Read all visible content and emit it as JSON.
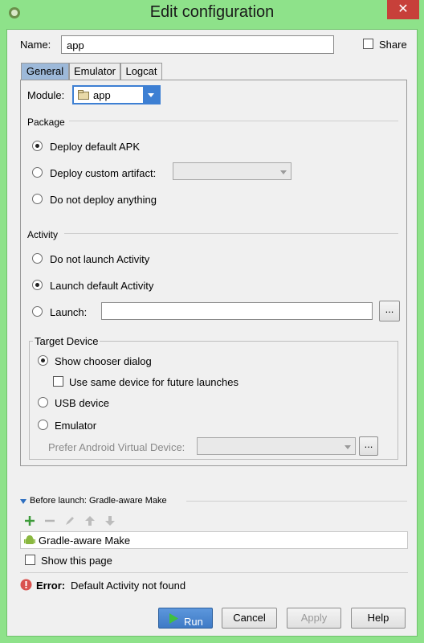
{
  "window": {
    "title": "Edit configuration",
    "close": "✕"
  },
  "name": {
    "label": "Name:",
    "value": "app",
    "share_label": "Share"
  },
  "tabs": [
    "General",
    "Emulator",
    "Logcat"
  ],
  "module": {
    "label": "Module:",
    "value": "app"
  },
  "package": {
    "heading": "Package",
    "options": [
      "Deploy default APK",
      "Deploy custom artifact:",
      "Do not deploy anything"
    ],
    "selected": 0
  },
  "activity": {
    "heading": "Activity",
    "options": [
      "Do not launch Activity",
      "Launch default Activity",
      "Launch:"
    ],
    "selected": 1,
    "browse": "..."
  },
  "target": {
    "heading": "Target Device",
    "show_chooser": "Show chooser dialog",
    "use_same": "Use same device for future launches",
    "usb": "USB device",
    "emulator": "Emulator",
    "prefer_avd": "Prefer Android Virtual Device:",
    "browse": "..."
  },
  "before_launch": {
    "heading": "Before launch: Gradle-aware Make",
    "item": "Gradle-aware Make",
    "show_page": "Show this page"
  },
  "error": {
    "prefix": "Error:",
    "text": "Default Activity not found"
  },
  "buttons": {
    "run": "Run",
    "cancel": "Cancel",
    "apply": "Apply",
    "help": "Help"
  }
}
